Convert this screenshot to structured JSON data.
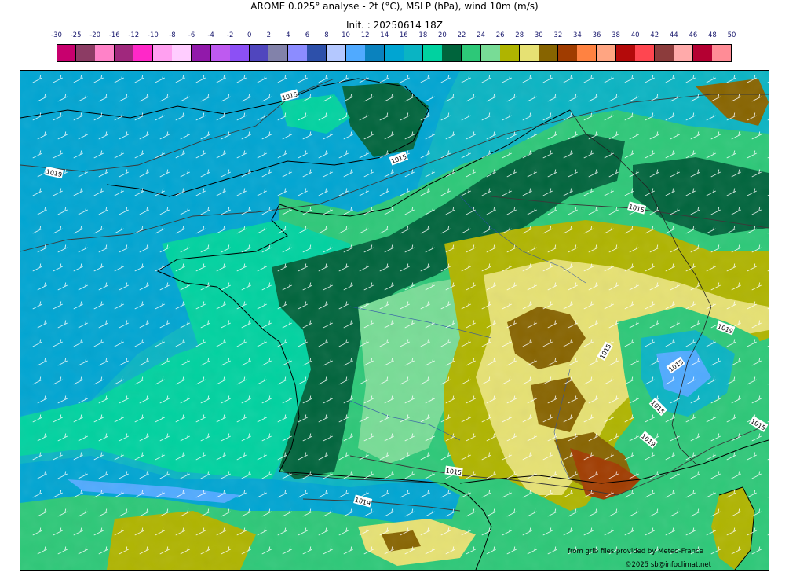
{
  "header": {
    "title": "AROME 0.025° analyse - 2t (°C), MSLP (hPa), wind 10m (m/s)",
    "init": "Init. : 20250614 18Z"
  },
  "legend": {
    "ticks": [
      "-30",
      "-25",
      "-20",
      "-16",
      "-12",
      "-10",
      "-8",
      "-6",
      "-4",
      "-2",
      "0",
      "2",
      "4",
      "6",
      "8",
      "10",
      "12",
      "14",
      "16",
      "18",
      "20",
      "22",
      "24",
      "26",
      "28",
      "30",
      "32",
      "34",
      "36",
      "38",
      "40",
      "42",
      "44",
      "46",
      "48",
      "50"
    ],
    "colors": [
      "#c8006e",
      "#8c3c64",
      "#ff82c8",
      "#a0287d",
      "#ff28c8",
      "#ffa0f0",
      "#ffcdff",
      "#9119aa",
      "#be5af0",
      "#8c50f5",
      "#5046be",
      "#8282aa",
      "#8c8cff",
      "#2d50aa",
      "#b4c8ff",
      "#50aaff",
      "#0a82be",
      "#00a5d2",
      "#0ab4c3",
      "#00d2a0",
      "#00643c",
      "#2dc878",
      "#78dc96",
      "#afb400",
      "#e6e173",
      "#876400",
      "#a03c00",
      "#ff8241",
      "#ffa582",
      "#b40a0a",
      "#ff4650",
      "#8c3c3c",
      "#ffaaaa",
      "#b40032",
      "#ff8c96"
    ]
  },
  "map": {
    "isobars": [
      "1015",
      "1019",
      "1015",
      "1015",
      "1015",
      "1019",
      "1019",
      "1015",
      "1015",
      "1015",
      "1019",
      "1015"
    ],
    "credits": {
      "source": "from grib files provided by Meteo-France",
      "copyright": "©2025 sb@infoclimat.net"
    }
  }
}
